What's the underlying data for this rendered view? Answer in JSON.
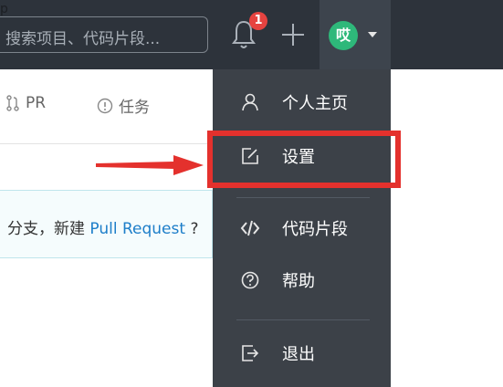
{
  "top_nav": {
    "partial_char": "p",
    "search_placeholder": "搜索项目、代码片段...",
    "notification_count": "1",
    "avatar_initial": "哎"
  },
  "tabs": [
    {
      "label": "PR"
    },
    {
      "label": "任务"
    }
  ],
  "notice": {
    "prefix": "分支，新建 ",
    "link": "Pull Request",
    "suffix": " ?"
  },
  "menu": {
    "items": [
      {
        "label": "个人主页",
        "icon": "user-icon"
      },
      {
        "label": "设置",
        "icon": "edit-icon"
      },
      {
        "label": "代码片段",
        "icon": "code-icon"
      },
      {
        "label": "帮助",
        "icon": "help-icon"
      },
      {
        "label": "退出",
        "icon": "logout-icon"
      }
    ]
  },
  "colors": {
    "nav_bg": "#2d333b",
    "menu_bg": "#3c4148",
    "avatar_bg": "#2eb87a",
    "badge_bg": "#e64340",
    "highlight": "#e4312d",
    "link": "#1d7ec9"
  }
}
